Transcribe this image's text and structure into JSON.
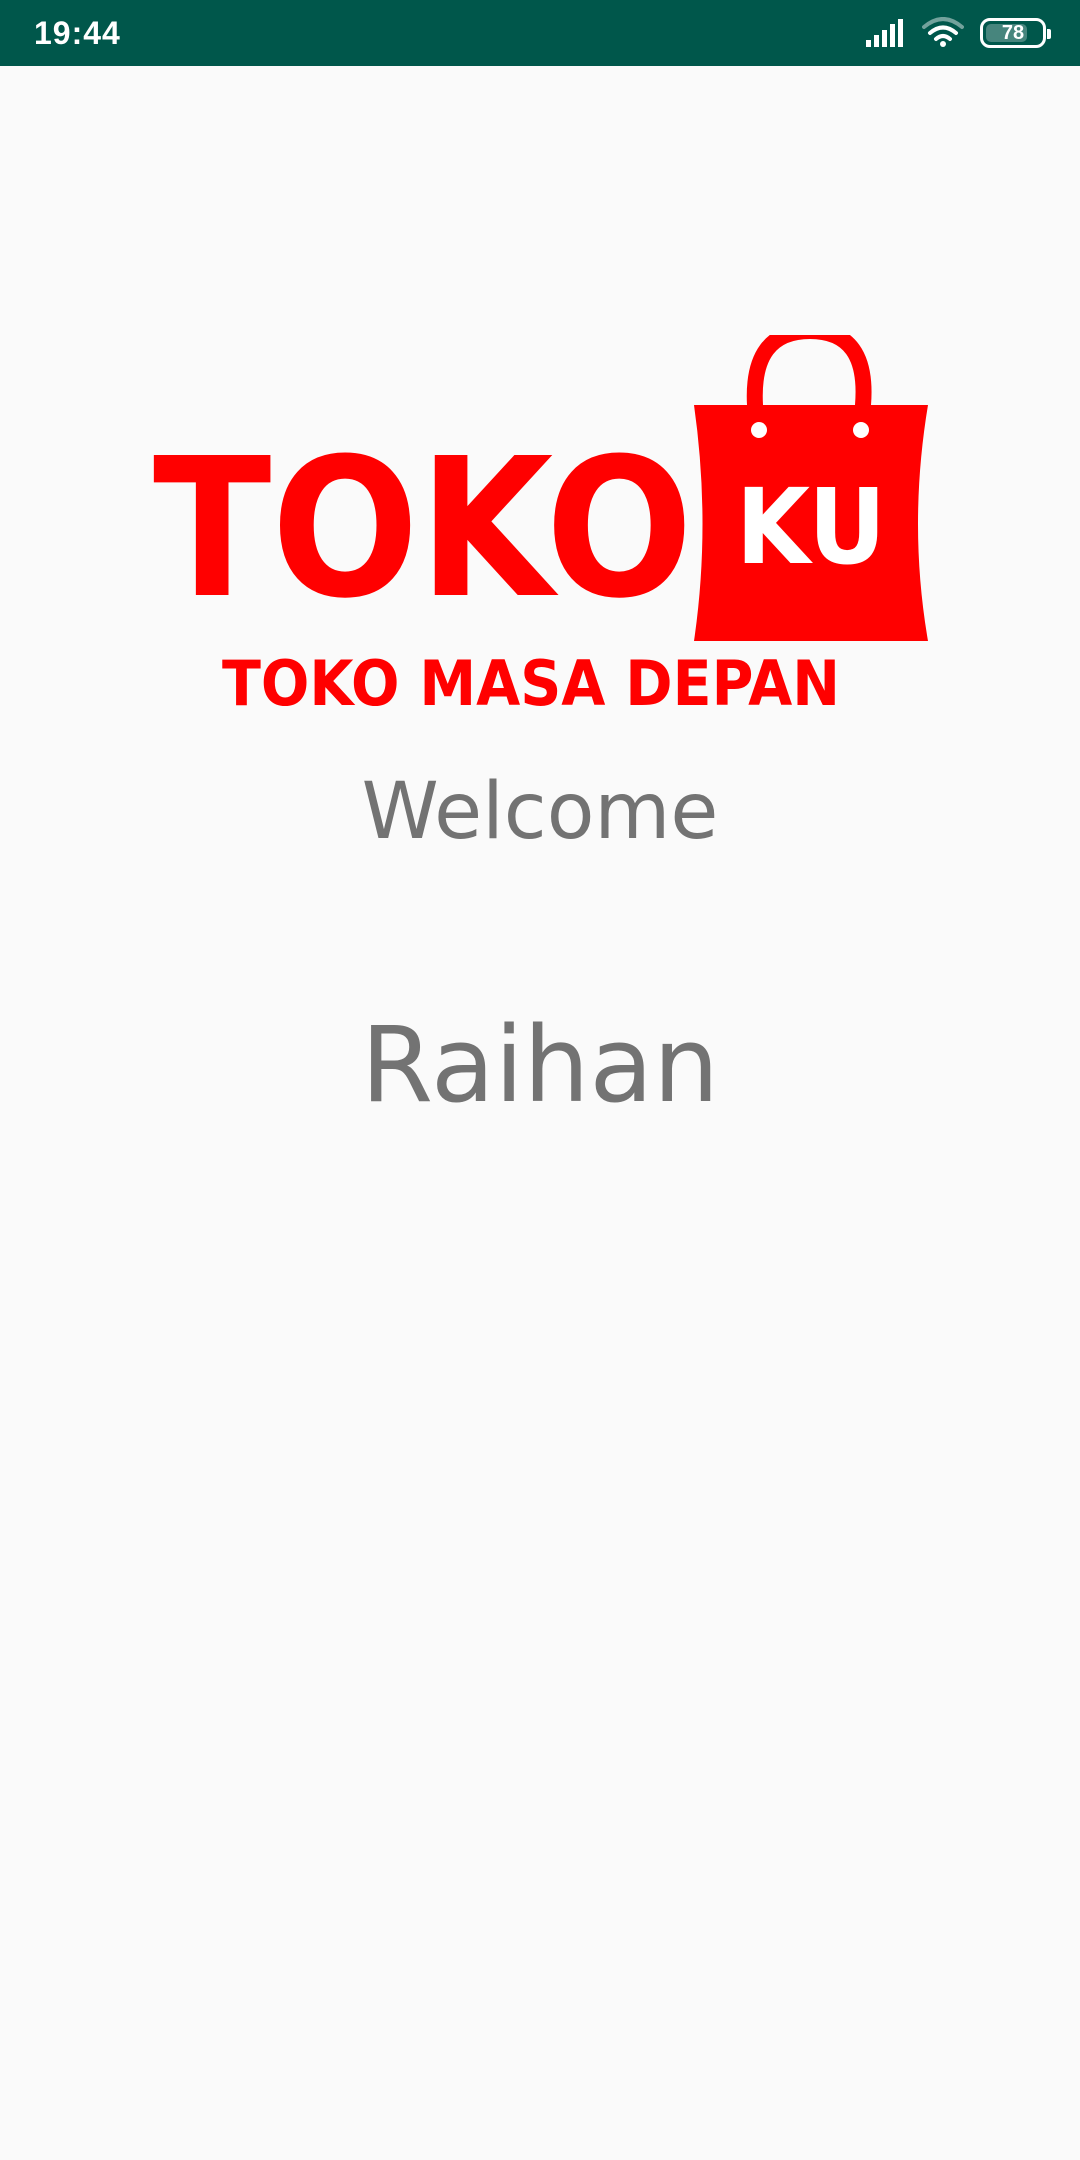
{
  "status_bar": {
    "time": "19:44",
    "battery_level": "78",
    "battery_fraction": 0.78,
    "icons": [
      "signal-icon",
      "wifi-icon",
      "battery-icon"
    ]
  },
  "logo": {
    "brand_main": "TOKO",
    "brand_bag": "KU",
    "tagline": "TOKO MASA DEPAN",
    "color": "#ff0000"
  },
  "main": {
    "welcome": "Welcome",
    "username": "Raihan"
  },
  "colors": {
    "status_bar": "#00574b",
    "text": "#737373",
    "background": "#fafafa"
  }
}
